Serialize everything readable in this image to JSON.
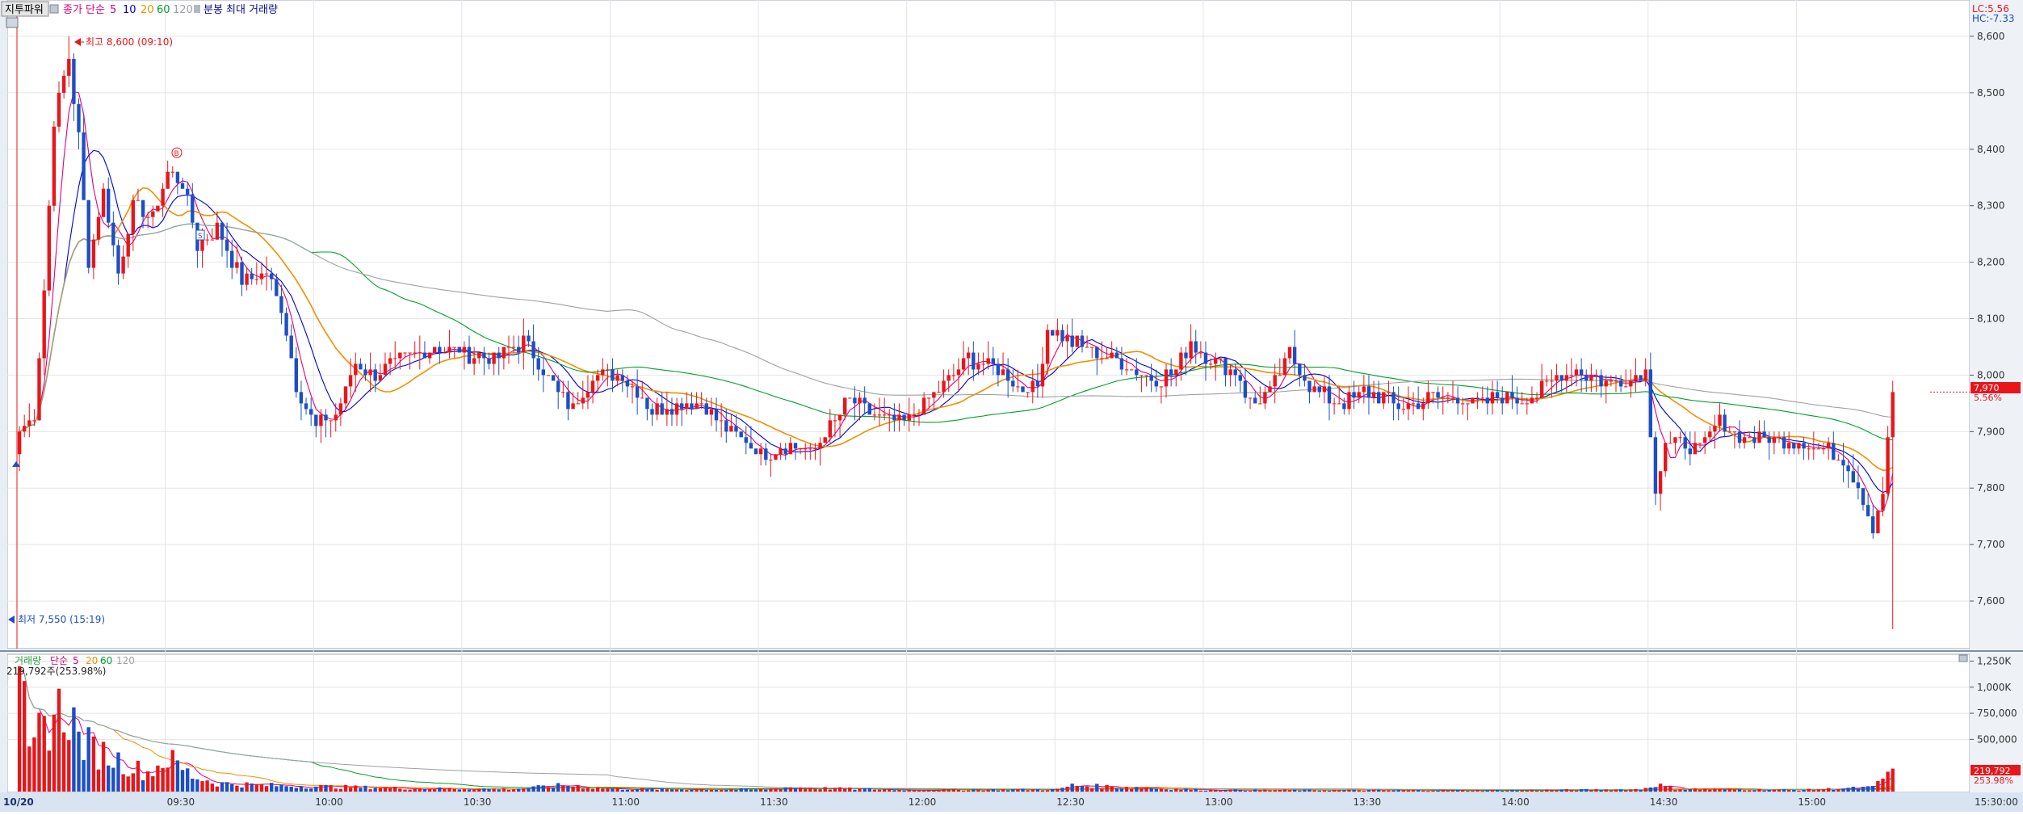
{
  "header": {
    "tool_label": "지투파워",
    "legend_prefix": "종가 단순",
    "ma_periods": [
      "5",
      "10",
      "20",
      "60",
      "120"
    ],
    "ma_colors": [
      "#e0007a",
      "#0000cc",
      "#f09000",
      "#00a030",
      "#a0a0a0"
    ],
    "extra_label": "분봉 최대 거래량"
  },
  "right_info": {
    "lc": "LC:5.56",
    "hc": "HC:-7.33"
  },
  "current_price": {
    "value": 7970,
    "label": "7,970",
    "pct": "5.56%"
  },
  "annotations": {
    "high_label": "최고 8,600 (09:10)",
    "low_label": "최저 7,550 (15:19)"
  },
  "volume_header": {
    "label": "거래량",
    "ma_prefix": "단순",
    "periods": [
      "5",
      "20",
      "60",
      "120"
    ],
    "colors": [
      "#e0007a",
      "#f09000",
      "#00a030",
      "#a0a0a0"
    ],
    "current": "219,792주(253.98%)",
    "current_short": "219,792",
    "current_pct": "253.98%"
  },
  "colors": {
    "up": "#e8161b",
    "down": "#1d4fc4",
    "grid": "#e4e4e4",
    "axis_bg": "#d9e4f2"
  },
  "chart_data": {
    "type": "candlestick",
    "price_axis": {
      "ylim": [
        7520,
        8650
      ],
      "ticks": [
        7600,
        7700,
        7800,
        7900,
        8000,
        8100,
        8200,
        8300,
        8400,
        8500,
        8600
      ],
      "tick_labels": [
        "7,600",
        "7,700",
        "7,800",
        "7,900",
        "8,000",
        "8,100",
        "8,200",
        "8,300",
        "8,400",
        "8,500",
        "8,600"
      ]
    },
    "volume_axis": {
      "ylim": [
        0,
        1300000
      ],
      "ticks": [
        500000,
        750000,
        1000000,
        1250000
      ],
      "tick_labels": [
        "500,000",
        "750,000",
        "1,000K",
        "1,250K"
      ]
    },
    "time_axis": {
      "start": "09:00",
      "end": "15:30",
      "labels": [
        "10/20",
        "09:30",
        "10:00",
        "10:30",
        "11:00",
        "11:30",
        "12:00",
        "12:30",
        "13:00",
        "13:30",
        "14:00",
        "14:30",
        "15:00",
        "15:30:00"
      ]
    },
    "close_anchors": [
      [
        "09:00",
        7900
      ],
      [
        "09:03",
        7930
      ],
      [
        "09:05",
        8150
      ],
      [
        "09:07",
        8450
      ],
      [
        "09:10",
        8560
      ],
      [
        "09:12",
        8420
      ],
      [
        "09:14",
        8200
      ],
      [
        "09:17",
        8330
      ],
      [
        "09:20",
        8180
      ],
      [
        "09:23",
        8300
      ],
      [
        "09:27",
        8280
      ],
      [
        "09:30",
        8360
      ],
      [
        "09:33",
        8340
      ],
      [
        "09:36",
        8230
      ],
      [
        "09:40",
        8260
      ],
      [
        "09:45",
        8170
      ],
      [
        "09:50",
        8180
      ],
      [
        "09:53",
        8120
      ],
      [
        "09:56",
        7980
      ],
      [
        "10:00",
        7910
      ],
      [
        "10:04",
        7930
      ],
      [
        "10:08",
        8020
      ],
      [
        "10:12",
        8000
      ],
      [
        "10:18",
        8030
      ],
      [
        "10:24",
        8050
      ],
      [
        "10:30",
        8040
      ],
      [
        "10:36",
        8030
      ],
      [
        "10:42",
        8060
      ],
      [
        "10:48",
        7980
      ],
      [
        "10:52",
        7940
      ],
      [
        "10:56",
        8000
      ],
      [
        "11:02",
        8000
      ],
      [
        "11:08",
        7940
      ],
      [
        "11:14",
        7950
      ],
      [
        "11:18",
        7950
      ],
      [
        "11:22",
        7910
      ],
      [
        "11:26",
        7890
      ],
      [
        "11:30",
        7860
      ],
      [
        "11:36",
        7880
      ],
      [
        "11:40",
        7860
      ],
      [
        "11:45",
        7920
      ],
      [
        "11:48",
        7960
      ],
      [
        "11:54",
        7920
      ],
      [
        "12:00",
        7920
      ],
      [
        "12:04",
        7960
      ],
      [
        "12:08",
        7990
      ],
      [
        "12:12",
        8030
      ],
      [
        "12:18",
        8010
      ],
      [
        "12:22",
        7980
      ],
      [
        "12:26",
        7980
      ],
      [
        "12:28",
        8080
      ],
      [
        "12:33",
        8060
      ],
      [
        "12:38",
        8040
      ],
      [
        "12:44",
        8020
      ],
      [
        "12:50",
        7990
      ],
      [
        "12:54",
        8010
      ],
      [
        "12:57",
        8060
      ],
      [
        "13:02",
        8020
      ],
      [
        "13:06",
        8010
      ],
      [
        "13:09",
        7950
      ],
      [
        "13:13",
        7970
      ],
      [
        "13:17",
        8040
      ],
      [
        "13:22",
        7970
      ],
      [
        "13:28",
        7950
      ],
      [
        "13:32",
        7970
      ],
      [
        "13:36",
        7960
      ],
      [
        "13:40",
        7940
      ],
      [
        "13:45",
        7960
      ],
      [
        "13:50",
        7960
      ],
      [
        "13:55",
        7950
      ],
      [
        "14:00",
        7960
      ],
      [
        "14:06",
        7960
      ],
      [
        "14:10",
        7990
      ],
      [
        "14:14",
        8010
      ],
      [
        "14:20",
        7990
      ],
      [
        "14:25",
        7990
      ],
      [
        "14:29",
        8010
      ],
      [
        "14:31",
        7800
      ],
      [
        "14:33",
        7880
      ],
      [
        "14:36",
        7880
      ],
      [
        "14:40",
        7870
      ],
      [
        "14:44",
        7920
      ],
      [
        "14:48",
        7890
      ],
      [
        "14:54",
        7890
      ],
      [
        "15:00",
        7880
      ],
      [
        "15:06",
        7870
      ],
      [
        "15:10",
        7840
      ],
      [
        "15:13",
        7780
      ],
      [
        "15:15",
        7730
      ],
      [
        "15:17",
        7800
      ],
      [
        "15:19",
        7970
      ]
    ],
    "volume_anchors": [
      [
        "09:00",
        1200000
      ],
      [
        "09:02",
        300000
      ],
      [
        "09:04",
        550000
      ],
      [
        "09:07",
        750000
      ],
      [
        "09:10",
        800000
      ],
      [
        "09:12",
        500000
      ],
      [
        "09:15",
        400000
      ],
      [
        "09:18",
        350000
      ],
      [
        "09:22",
        250000
      ],
      [
        "09:26",
        180000
      ],
      [
        "09:30",
        320000
      ],
      [
        "09:35",
        150000
      ],
      [
        "09:40",
        80000
      ],
      [
        "09:50",
        60000
      ],
      [
        "10:00",
        50000
      ],
      [
        "10:10",
        40000
      ],
      [
        "10:20",
        30000
      ],
      [
        "10:40",
        25000
      ],
      [
        "10:50",
        60000
      ],
      [
        "11:00",
        25000
      ],
      [
        "11:30",
        20000
      ],
      [
        "11:35",
        40000
      ],
      [
        "12:00",
        15000
      ],
      [
        "12:30",
        20000
      ],
      [
        "12:33",
        60000
      ],
      [
        "13:00",
        15000
      ],
      [
        "14:00",
        12000
      ],
      [
        "14:28",
        20000
      ],
      [
        "14:31",
        70000
      ],
      [
        "14:35",
        25000
      ],
      [
        "15:00",
        15000
      ],
      [
        "15:15",
        40000
      ],
      [
        "15:19",
        219792
      ]
    ]
  }
}
